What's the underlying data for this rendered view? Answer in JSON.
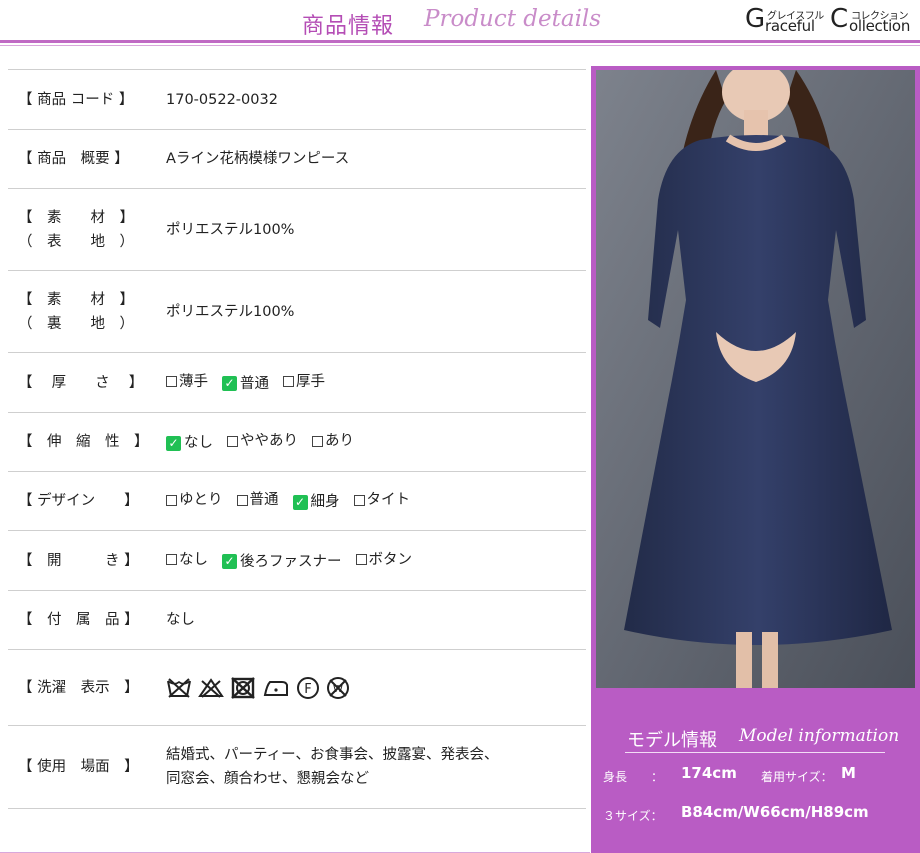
{
  "header": {
    "title_ja": "商品情報",
    "title_en": "Product details",
    "logo": {
      "g": "G",
      "g_small": "グレイスフル",
      "g_rest": "raceful",
      "c": "C",
      "c_small": "コレクション",
      "c_rest": "ollection"
    }
  },
  "specs": [
    {
      "label": "【 商品 コード 】",
      "value": "170-0522-0032"
    },
    {
      "label": "【 商品　概要 】",
      "value": "Aライン花柄模様ワンピース"
    },
    {
      "label": "【　素　　材　】\n（　表　　地　）",
      "value": "ポリエステル100%"
    },
    {
      "label": "【　素　　材　】\n（　裏　　地　）",
      "value": "ポリエステル100%"
    },
    {
      "label": "【　 厚　　さ　 】",
      "options": [
        {
          "text": "薄手",
          "checked": false
        },
        {
          "text": "普通",
          "checked": true
        },
        {
          "text": "厚手",
          "checked": false
        }
      ]
    },
    {
      "label": "【　伸　縮　性　】",
      "options": [
        {
          "text": "なし",
          "checked": true
        },
        {
          "text": "ややあり",
          "checked": false
        },
        {
          "text": "あり",
          "checked": false
        }
      ]
    },
    {
      "label": "【 デザイン　　】",
      "options": [
        {
          "text": "ゆとり",
          "checked": false
        },
        {
          "text": "普通",
          "checked": false
        },
        {
          "text": "細身",
          "checked": true
        },
        {
          "text": "タイト",
          "checked": false
        }
      ]
    },
    {
      "label": "【　開　　　き 】",
      "options": [
        {
          "text": "なし",
          "checked": false
        },
        {
          "text": "後ろファスナー",
          "checked": true
        },
        {
          "text": "ボタン",
          "checked": false
        }
      ]
    },
    {
      "label": "【　付　属　品 】",
      "value": "なし"
    },
    {
      "label": "【 洗濯　表示　】",
      "care_icons": [
        "no-wash-icon",
        "no-bleach-icon",
        "no-tumble-dry-icon",
        "iron-low-icon",
        "dry-clean-f-icon",
        "no-wet-clean-icon"
      ]
    },
    {
      "label": "【 使用　場面　】",
      "value": "結婚式、パーティー、お食事会、披露宴、発表会、\n同窓会、顔合わせ、懇親会など"
    }
  ],
  "model": {
    "title_ja": "モデル情報",
    "title_en": "Model information",
    "height_label": "身長　　：",
    "height_value": "174cm",
    "size_label": "着用サイズ：",
    "size_value": "M",
    "three_label": "３サイズ：",
    "three_value": "B84cm/W66cm/H89cm"
  },
  "colors": {
    "accent": "#b95cc4",
    "check": "#20c054"
  }
}
